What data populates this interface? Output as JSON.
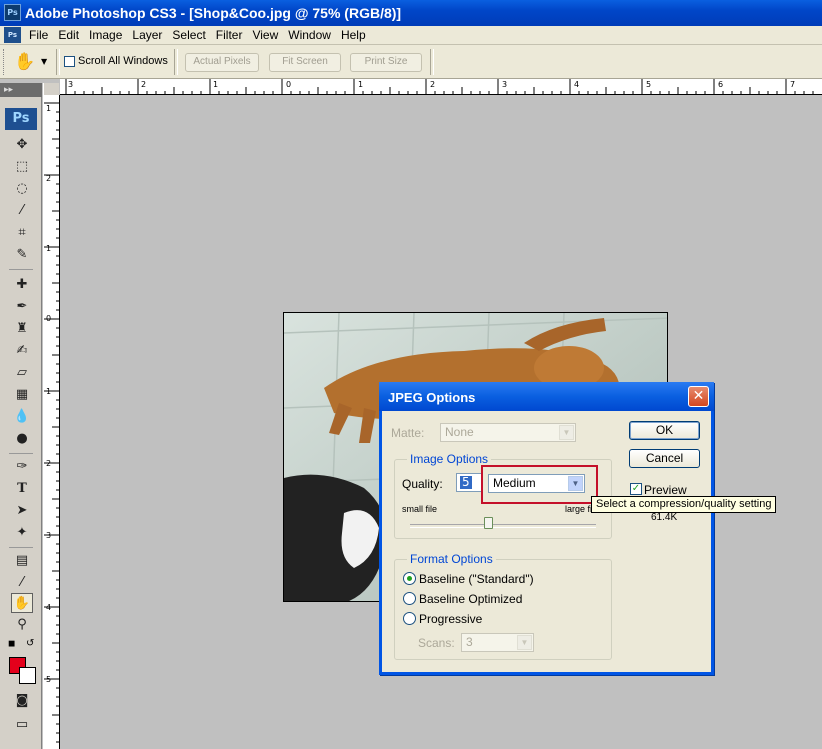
{
  "window": {
    "title": "Adobe Photoshop CS3 - [Shop&Coo.jpg @ 75% (RGB/8)]",
    "app_icon": "Ps"
  },
  "menubar": {
    "doc_icon": "Ps",
    "items": [
      "File",
      "Edit",
      "Image",
      "Layer",
      "Select",
      "Filter",
      "View",
      "Window",
      "Help"
    ]
  },
  "optionsbar": {
    "scroll_all_windows": "Scroll All Windows",
    "actual_pixels": "Actual Pixels",
    "fit_screen": "Fit Screen",
    "print_size": "Print Size"
  },
  "tools": {
    "badge": "Ps",
    "header": "▸▸"
  },
  "ruler": {
    "h_labels": [
      "3",
      "2",
      "1",
      "0",
      "1",
      "2",
      "3",
      "4",
      "5",
      "6",
      "7"
    ],
    "v_labels": [
      "1",
      "2",
      "1",
      "0",
      "1",
      "2",
      "3",
      "4",
      "5"
    ]
  },
  "dialog": {
    "title": "JPEG Options",
    "close": "✕",
    "matte_label": "Matte:",
    "matte_value": "None",
    "ok": "OK",
    "cancel": "Cancel",
    "image_options": {
      "title": "Image Options",
      "quality_label": "Quality:",
      "quality_value": "5",
      "quality_preset": "Medium",
      "small_file": "small file",
      "large_file": "large fi"
    },
    "preview_label": "Preview",
    "file_size": "61.4K",
    "format_options": {
      "title": "Format Options",
      "options": [
        "Baseline (\"Standard\")",
        "Baseline Optimized",
        "Progressive"
      ],
      "selected": "Baseline (\"Standard\")",
      "scans_label": "Scans:",
      "scans_value": "3"
    }
  },
  "tooltip": "Select a compression/quality setting",
  "colors": {
    "foreground": "#e3001b",
    "background": "#ffffff",
    "titlebar": "#0a5fe0"
  }
}
